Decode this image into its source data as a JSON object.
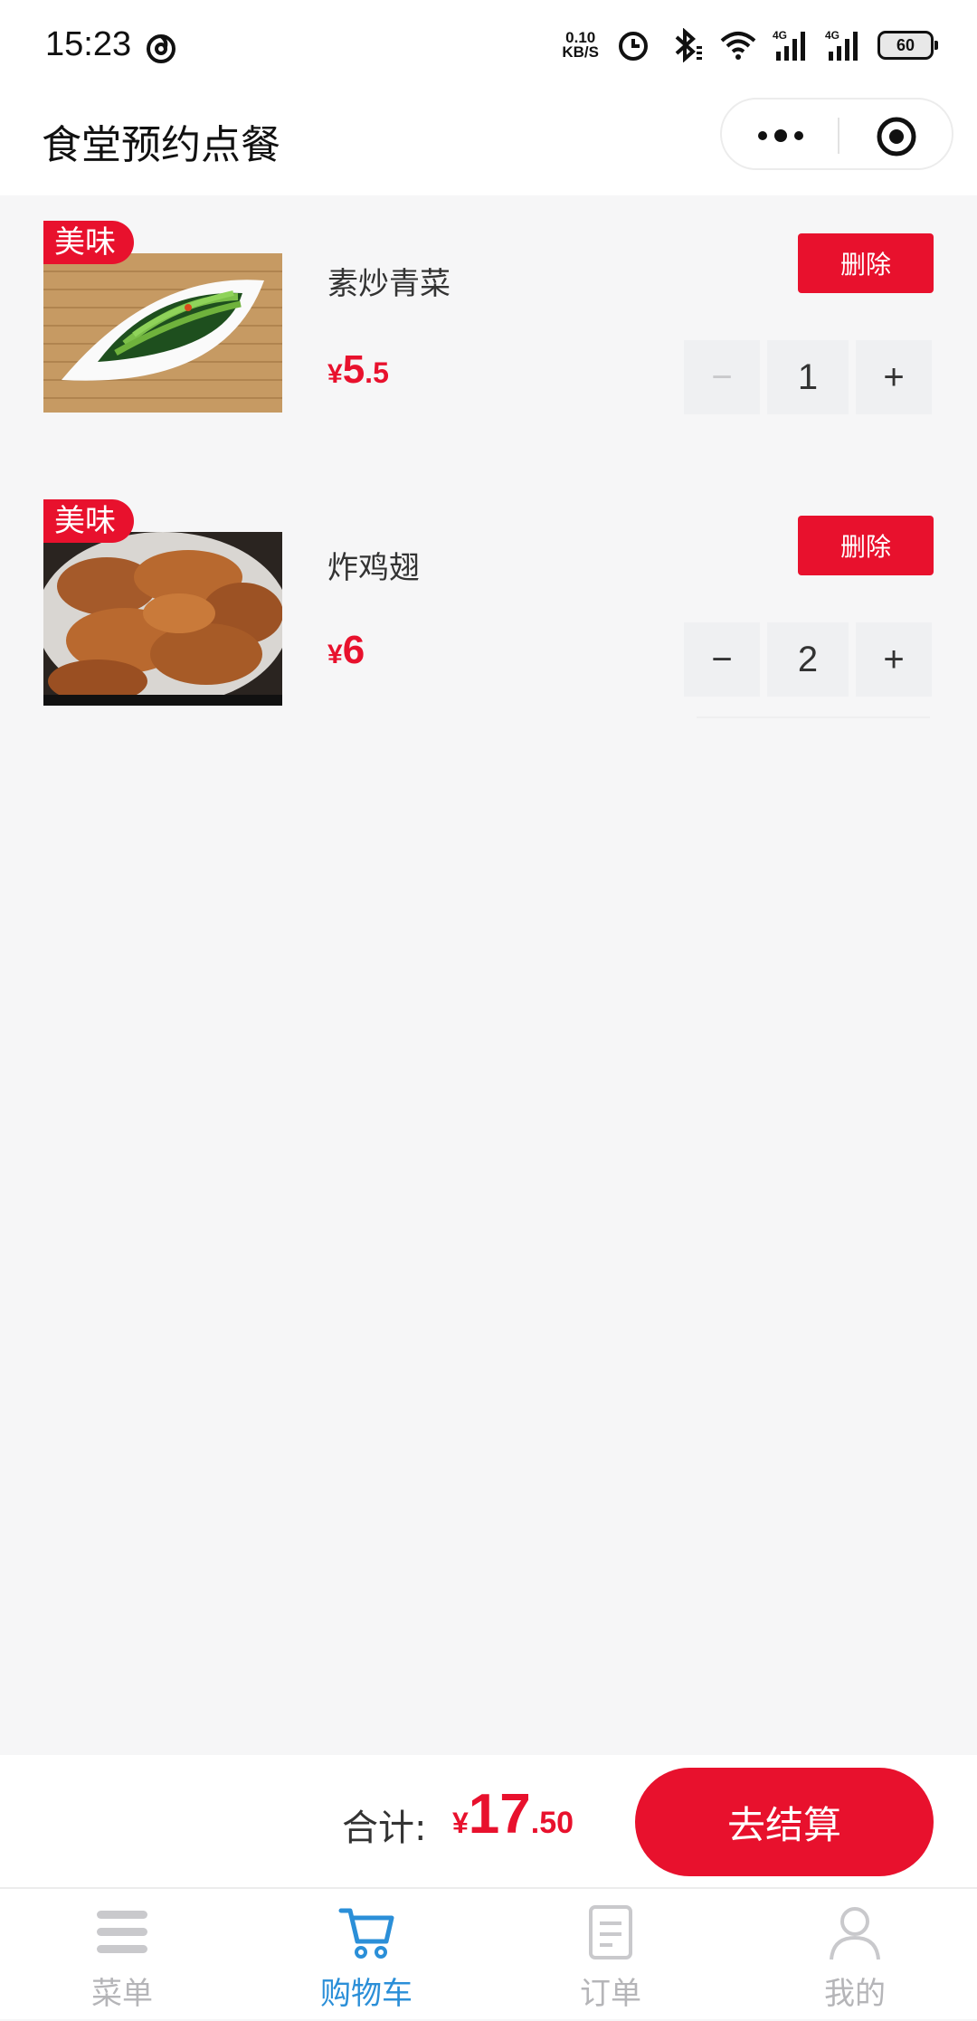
{
  "status_bar": {
    "time": "15:23",
    "net_speed_value": "0.10",
    "net_speed_unit": "KB/S",
    "battery": "60",
    "icons": [
      "swirl-icon",
      "alarm-icon",
      "bluetooth-icon",
      "wifi-icon",
      "signal-4g-icon",
      "signal-4g-icon"
    ]
  },
  "header": {
    "title": "食堂预约点餐",
    "icons": [
      "more-icon",
      "target-icon"
    ]
  },
  "cart": {
    "items": [
      {
        "tag": "美味",
        "name": "素炒青菜",
        "price_symbol": "¥",
        "price_int": "5",
        "price_dec": ".5",
        "delete_label": "删除",
        "quantity": "1",
        "minus": "−",
        "plus": "+",
        "minus_disabled": true
      },
      {
        "tag": "美味",
        "name": "炸鸡翅",
        "price_symbol": "¥",
        "price_int": "6",
        "price_dec": "",
        "delete_label": "删除",
        "quantity": "2",
        "minus": "−",
        "plus": "+",
        "minus_disabled": false
      }
    ]
  },
  "checkout": {
    "total_label": "合计:",
    "total_symbol": "¥",
    "total_int": "17",
    "total_dec": ".50",
    "button_label": "去结算"
  },
  "tabbar": {
    "items": [
      {
        "label": "菜单",
        "icon": "menu-icon",
        "active": false
      },
      {
        "label": "购物车",
        "icon": "cart-icon",
        "active": true
      },
      {
        "label": "订单",
        "icon": "order-icon",
        "active": false
      },
      {
        "label": "我的",
        "icon": "user-icon",
        "active": false
      }
    ]
  },
  "colors": {
    "accent": "#e8112d",
    "tab_active": "#2b8fd8",
    "tab_inactive": "#b5b5b8",
    "background": "#f6f6f7"
  }
}
